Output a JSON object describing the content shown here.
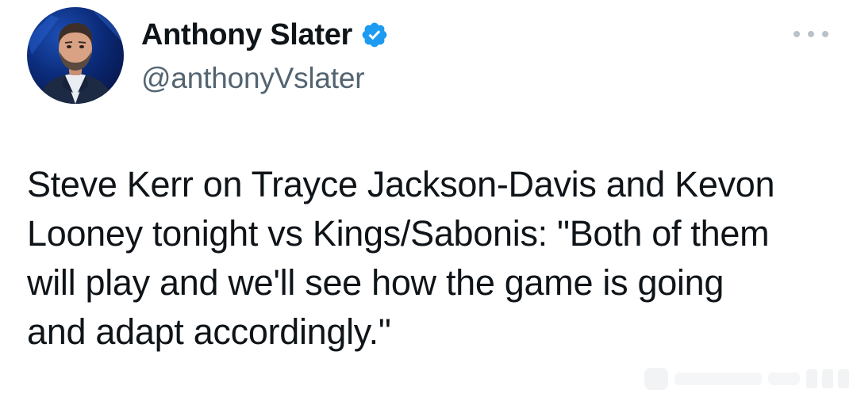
{
  "author": {
    "display_name": "Anthony Slater",
    "handle": "@anthonyVslater",
    "verified": true,
    "verified_color": "#1d9bf0"
  },
  "tweet": {
    "text": "Steve Kerr on Trayce Jackson-Davis and Kevon\nLooney tonight vs Kings/Sabonis: \"Both of them\nwill play and we'll see how the game is going\nand adapt accordingly.\""
  },
  "icons": {
    "avatar": "profile-photo",
    "verified": "verified-badge-icon",
    "more": "more-options-icon"
  },
  "colors": {
    "text_primary": "#0f1419",
    "text_secondary": "#536471",
    "background": "#ffffff"
  }
}
